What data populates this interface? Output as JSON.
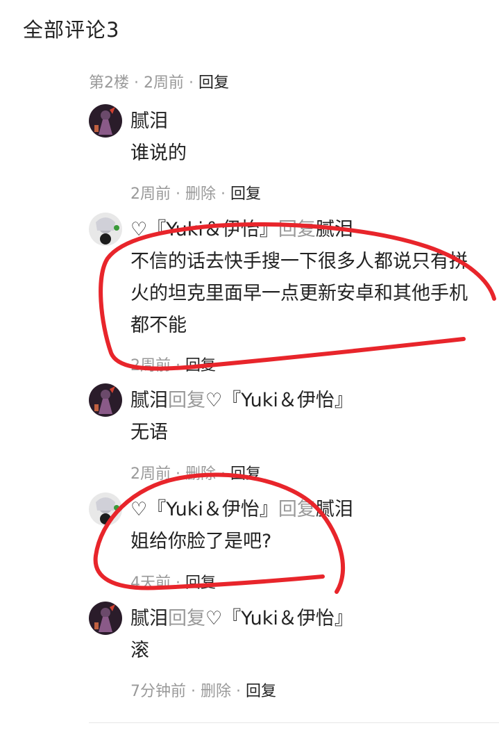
{
  "header": {
    "title": "全部评论3"
  },
  "floor": {
    "label": "第2楼",
    "time": "2周前",
    "reply": "回复",
    "sep": "·"
  },
  "replies": [
    {
      "name": "腻泪",
      "text": "谁说的",
      "time": "2周前",
      "delete": "删除",
      "reply": "回复"
    },
    {
      "name": "♡『Yuki＆伊怡』",
      "verb": "回复",
      "target": "腻泪",
      "text": "不信的话去快手搜一下很多人都说只有拼火的坦克里面早一点更新安卓和其他手机都不能",
      "time": "2周前",
      "reply": "回复"
    },
    {
      "name": "腻泪",
      "verb": "回复",
      "target": "♡『Yuki＆伊怡』",
      "text": "无语",
      "time": "2周前",
      "delete": "删除",
      "reply": "回复"
    },
    {
      "name": "♡『Yuki＆伊怡』",
      "verb": "回复",
      "target": "腻泪",
      "text": "姐给你脸了是吧?",
      "time": "4天前",
      "reply": "回复"
    },
    {
      "name": "腻泪",
      "verb": "回复",
      "target": "♡『Yuki＆伊怡』",
      "text": "滚",
      "time": "7分钟前",
      "delete": "删除",
      "reply": "回复"
    }
  ],
  "icons": {
    "avatar_a": "dark-character-avatar",
    "avatar_b": "anime-girl-avatar"
  },
  "colors": {
    "annotation": "#e8252b",
    "muted": "#999999",
    "text": "#222222"
  }
}
